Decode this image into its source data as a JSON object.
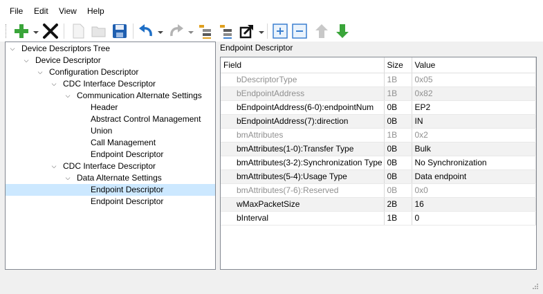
{
  "menu": {
    "file": "File",
    "edit": "Edit",
    "view": "View",
    "help": "Help"
  },
  "toolbar": {
    "icons": [
      "add-icon",
      "delete-icon",
      "new-file-icon",
      "open-folder-icon",
      "save-icon",
      "undo-icon",
      "redo-icon",
      "list-icon",
      "list-alt-icon",
      "export-icon",
      "expand-icon",
      "collapse-icon",
      "move-up-icon",
      "move-down-icon"
    ]
  },
  "tree": {
    "items": [
      {
        "label": "Device Descriptors Tree",
        "expanded": true
      },
      {
        "label": "Device Descriptor",
        "expanded": true
      },
      {
        "label": "Configuration Descriptor",
        "expanded": true
      },
      {
        "label": "CDC Interface Descriptor",
        "expanded": true
      },
      {
        "label": "Communication Alternate Settings",
        "expanded": true
      },
      {
        "label": "Header"
      },
      {
        "label": "Abstract Control Management"
      },
      {
        "label": "Union"
      },
      {
        "label": "Call Management"
      },
      {
        "label": "Endpoint Descriptor"
      },
      {
        "label": "CDC Interface Descriptor",
        "expanded": true
      },
      {
        "label": "Data Alternate Settings",
        "expanded": true
      },
      {
        "label": "Endpoint Descriptor",
        "selected": true
      },
      {
        "label": "Endpoint Descriptor"
      }
    ]
  },
  "details": {
    "title": "Endpoint Descriptor",
    "columns": {
      "field": "Field",
      "size": "Size",
      "value": "Value"
    },
    "rows": [
      {
        "field": "bDescriptorType",
        "size": "1B",
        "value": "0x05",
        "dim": true
      },
      {
        "field": "bEndpointAddress",
        "size": "1B",
        "value": "0x82",
        "dim": true
      },
      {
        "field": "bEndpointAddress(6-0):endpointNum",
        "size": "0B",
        "value": "EP2"
      },
      {
        "field": "bEndpointAddress(7):direction",
        "size": "0B",
        "value": "IN"
      },
      {
        "field": "bmAttributes",
        "size": "1B",
        "value": "0x2",
        "dim": true
      },
      {
        "field": "bmAttributes(1-0):Transfer Type",
        "size": "0B",
        "value": "Bulk"
      },
      {
        "field": "bmAttributes(3-2):Synchronization Type",
        "size": "0B",
        "value": "No Synchronization"
      },
      {
        "field": "bmAttributes(5-4):Usage Type",
        "size": "0B",
        "value": "Data endpoint"
      },
      {
        "field": "bmAttributes(7-6):Reserved",
        "size": "0B",
        "value": "0x0",
        "dim": true
      },
      {
        "field": "wMaxPacketSize",
        "size": "2B",
        "value": "16"
      },
      {
        "field": "bInterval",
        "size": "1B",
        "value": "0"
      }
    ]
  },
  "colors": {
    "selection": "#cce8ff",
    "add": "#3aa53a",
    "undo": "#1e6fc6",
    "move_down": "#3aa53a"
  }
}
